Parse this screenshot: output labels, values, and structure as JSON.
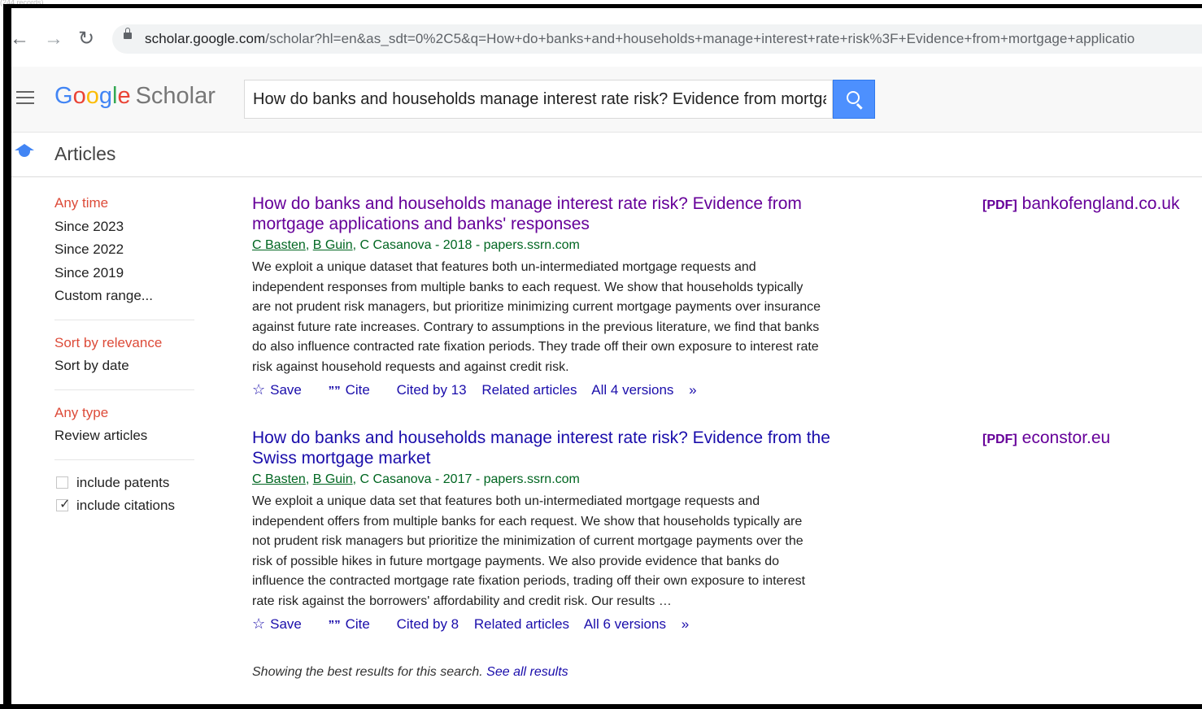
{
  "corner_text": "(244 records)",
  "browser": {
    "url_host": "scholar.google.com",
    "url_rest": "/scholar?hl=en&as_sdt=0%2C5&q=How+do+banks+and+households+manage+interest+rate+risk%3F+Evidence+from+mortgage+applicatio"
  },
  "header": {
    "logo_letters": [
      "G",
      "o",
      "o",
      "g",
      "l",
      "e"
    ],
    "logo_product": "Scholar",
    "search_value": "How do banks and households manage interest rate risk? Evidence from mortgage applications and banks' responses"
  },
  "articles_label": "Articles",
  "sidebar": {
    "time_items": [
      "Any time",
      "Since 2023",
      "Since 2022",
      "Since 2019",
      "Custom range..."
    ],
    "sort_items": [
      "Sort by relevance",
      "Sort by date"
    ],
    "type_items": [
      "Any type",
      "Review articles"
    ],
    "include_patents": "include patents",
    "include_citations": "include citations"
  },
  "results": [
    {
      "title_line1": "How do banks and households manage interest rate risk? Evidence from",
      "title_line2": "mortgage applications and banks' responses",
      "author1": "C Basten",
      "author2": "B Guin",
      "meta_rest": ", C Casanova - 2018 - papers.ssrn.com",
      "snippet": "We exploit a unique dataset that features both un-intermediated mortgage requests and independent responses from multiple banks to each request. We show that households typically are not prudent risk managers, but prioritize minimizing current mortgage payments over insurance against future rate increases. Contrary to assumptions in the previous literature, we find that banks do also influence contracted rate fixation periods. They trade off their own exposure to interest rate risk against household requests and against credit risk.",
      "save": "Save",
      "cite": "Cite",
      "cited_by": "Cited by 13",
      "related": "Related articles",
      "versions": "All 4 versions",
      "more": "»",
      "pdf_tag": "[PDF]",
      "pdf_source": "bankofengland.co.uk"
    },
    {
      "title_line1": "How do banks and households manage interest rate risk? Evidence from the",
      "title_line2": "Swiss mortgage market",
      "author1": "C Basten",
      "author2": "B Guin",
      "meta_rest": ", C Casanova - 2017 - papers.ssrn.com",
      "snippet": "We exploit a unique data set that features both un-intermediated mortgage requests and independent offers from multiple banks for each request. We show that households typically are not prudent risk managers but prioritize the minimization of current mortgage payments over the risk of possible hikes in future mortgage payments. We also provide evidence that banks do influence the contracted mortgage rate fixation periods, trading off their own exposure to interest rate risk against the borrowers' affordability and credit risk. Our results …",
      "save": "Save",
      "cite": "Cite",
      "cited_by": "Cited by 8",
      "related": "Related articles",
      "versions": "All 6 versions",
      "more": "»",
      "pdf_tag": "[PDF]",
      "pdf_source": "econstor.eu"
    }
  ],
  "footer": {
    "note": "Showing the best results for this search.",
    "link": "See all results"
  }
}
